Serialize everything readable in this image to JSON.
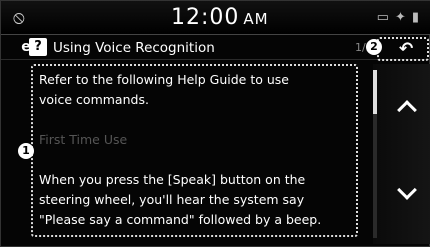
{
  "status": {
    "time": "12:00",
    "ampm": "AM",
    "icons": [
      "bluetooth-icon",
      "signal-icon",
      "battery-icon"
    ]
  },
  "header": {
    "title": "Using Voice Recognition",
    "page_indicator": "1/3",
    "back_label": "↶"
  },
  "callouts": {
    "one": "1",
    "two": "2"
  },
  "content": {
    "lines": [
      "Refer to the following Help Guide to use",
      "voice commands.",
      "",
      "First Time Use",
      "",
      "When you press the [Speak] button on the",
      "steering wheel, you'll hear the system say",
      "\"Please say a command\" followed by a beep."
    ]
  },
  "scroll": {
    "position_fraction": 0.0
  }
}
